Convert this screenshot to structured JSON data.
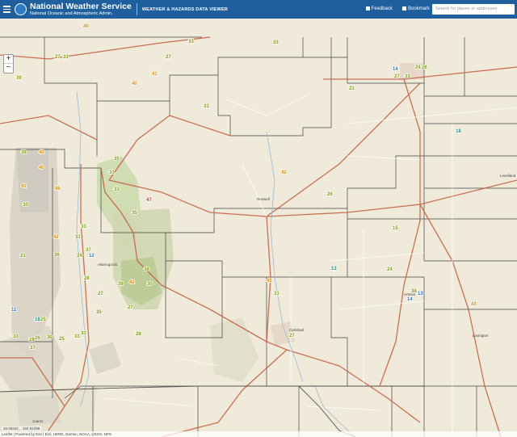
{
  "header": {
    "org_title": "National Weather Service",
    "org_subtitle": "National Oceanic and Atmospheric Admin.",
    "app_title": "WEATHER & HAZARDS DATA VIEWER",
    "feedback_label": "Feedback",
    "bookmark_label": "Bookmark",
    "search_placeholder": "Search for places or addresses"
  },
  "map": {
    "zoom_in": "+",
    "zoom_out": "−",
    "coordinates": "33.00222 , -104.91298",
    "attribution": "Leaflet | Powered by Esri | Esri, HERE, Garmin, NOAA, USGS, NPS",
    "places": [
      "Roswell",
      "Carlsbad",
      "Alamogordo",
      "Juarez",
      "Lovington",
      "Levelland",
      "Artesia"
    ],
    "stations": [
      {
        "v": "40",
        "c": "orange"
      },
      {
        "v": "33",
        "c": "green"
      },
      {
        "v": "33",
        "c": "green"
      },
      {
        "v": "27",
        "c": "green"
      },
      {
        "v": "33",
        "c": "green"
      },
      {
        "v": "27",
        "c": "green"
      },
      {
        "v": "39",
        "c": "green"
      },
      {
        "v": "41",
        "c": "orange"
      },
      {
        "v": "40",
        "c": "orange"
      },
      {
        "v": "27",
        "c": "green"
      },
      {
        "v": "33",
        "c": "green"
      },
      {
        "v": "21",
        "c": "green"
      },
      {
        "v": "14",
        "c": "blue"
      },
      {
        "v": "26",
        "c": "green"
      },
      {
        "v": "24",
        "c": "green"
      },
      {
        "v": "33",
        "c": "green"
      },
      {
        "v": "18",
        "c": "teal"
      },
      {
        "v": "35",
        "c": "green"
      },
      {
        "v": "39",
        "c": "green"
      },
      {
        "v": "40",
        "c": "orange"
      },
      {
        "v": "41",
        "c": "orange"
      },
      {
        "v": "40",
        "c": "orange"
      },
      {
        "v": "31",
        "c": "green"
      },
      {
        "v": "33",
        "c": "green"
      },
      {
        "v": "47",
        "c": "red"
      },
      {
        "v": "26",
        "c": "green"
      },
      {
        "v": "42",
        "c": "orange"
      },
      {
        "v": "45",
        "c": "orange"
      },
      {
        "v": "35",
        "c": "green"
      },
      {
        "v": "30",
        "c": "green"
      },
      {
        "v": "15",
        "c": "green"
      },
      {
        "v": "31",
        "c": "green"
      },
      {
        "v": "33",
        "c": "green"
      },
      {
        "v": "42",
        "c": "orange"
      },
      {
        "v": "37",
        "c": "green"
      },
      {
        "v": "36",
        "c": "green"
      },
      {
        "v": "21",
        "c": "green"
      },
      {
        "v": "24",
        "c": "green"
      },
      {
        "v": "12",
        "c": "blue"
      },
      {
        "v": "24",
        "c": "green"
      },
      {
        "v": "13",
        "c": "teal"
      },
      {
        "v": "38",
        "c": "green"
      },
      {
        "v": "42",
        "c": "orange"
      },
      {
        "v": "30",
        "c": "green"
      },
      {
        "v": "28",
        "c": "green"
      },
      {
        "v": "39",
        "c": "green"
      },
      {
        "v": "45",
        "c": "orange"
      },
      {
        "v": "27",
        "c": "green"
      },
      {
        "v": "35",
        "c": "green"
      },
      {
        "v": "11",
        "c": "blue"
      },
      {
        "v": "31",
        "c": "green"
      },
      {
        "v": "38",
        "c": "green"
      },
      {
        "v": "13",
        "c": "blue"
      },
      {
        "v": "14",
        "c": "blue"
      },
      {
        "v": "43",
        "c": "orange"
      },
      {
        "v": "27",
        "c": "green"
      },
      {
        "v": "18",
        "c": "teal"
      },
      {
        "v": "25",
        "c": "green"
      },
      {
        "v": "33",
        "c": "green"
      },
      {
        "v": "28",
        "c": "green"
      },
      {
        "v": "33",
        "c": "green"
      },
      {
        "v": "27",
        "c": "green"
      },
      {
        "v": "33",
        "c": "green"
      },
      {
        "v": "28",
        "c": "green"
      },
      {
        "v": "30",
        "c": "green"
      },
      {
        "v": "26",
        "c": "green"
      },
      {
        "v": "25",
        "c": "green"
      },
      {
        "v": "37",
        "c": "green"
      }
    ]
  },
  "colors": {
    "orange": "#d38a00",
    "green": "#7a9a00",
    "blue": "#1f6fc0",
    "teal": "#1a8c8c",
    "red": "#c0392b"
  }
}
